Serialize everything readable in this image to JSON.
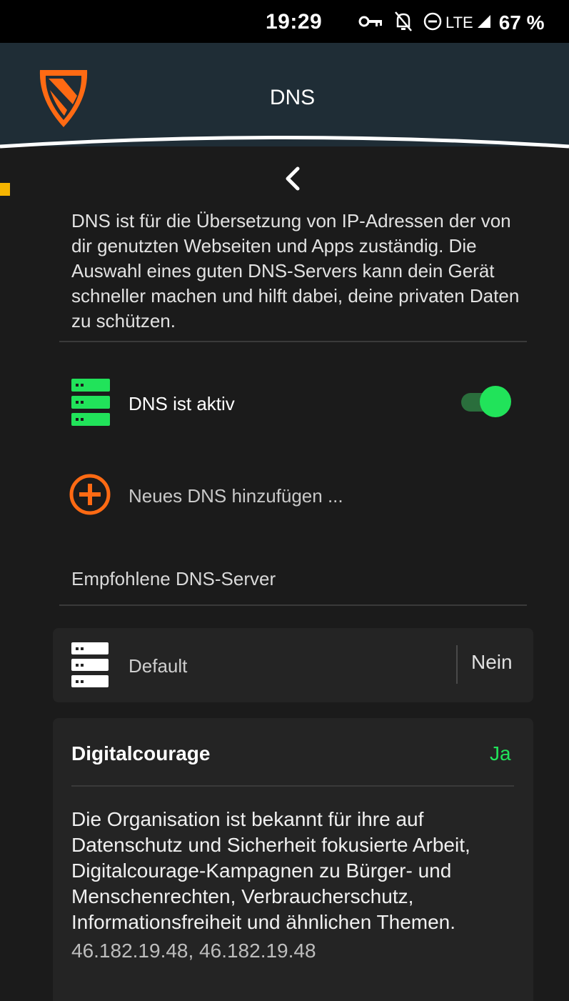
{
  "status_bar": {
    "time": "19:29",
    "network": "LTE",
    "battery": "67 %",
    "icons": [
      "vpn-key-icon",
      "notifications-off-icon",
      "do-not-disturb-icon",
      "signal-icon"
    ]
  },
  "header": {
    "title": "DNS",
    "logo_icon": "shield-logo-icon"
  },
  "intro_text": "DNS ist für die Übersetzung von IP-Adressen der von dir genutzten Webseiten und Apps zuständig. Die Auswahl eines guten DNS-Servers kann dein Gerät schneller machen und hilft dabei, deine privaten Daten zu schützen.",
  "dns_toggle": {
    "label": "DNS ist aktiv",
    "enabled": true
  },
  "add_dns": {
    "label": "Neues DNS hinzufügen ..."
  },
  "recommended_title": "Empfohlene DNS-Server",
  "servers": [
    {
      "name": "Default",
      "status": "Nein"
    },
    {
      "name": "Digitalcourage",
      "status": "Ja",
      "description": "Die Organisation ist bekannt für ihre auf Datenschutz und Sicherheit fokusierte Arbeit, Digitalcourage-Kampagnen zu Bürger- und Menschenrechten, Verbraucherschutz, Informationsfreiheit und ähnlichen Themen.",
      "addresses": "46.182.19.48, 46.182.19.48"
    }
  ],
  "colors": {
    "accent_green": "#21e35a",
    "accent_orange": "#ff6a13",
    "header_bg": "#1f2d36",
    "page_bg": "#1b1b1b"
  }
}
